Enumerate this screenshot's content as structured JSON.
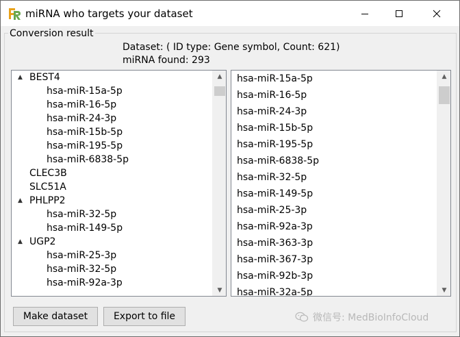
{
  "window": {
    "title": "miRNA who targets your dataset",
    "app_icon": "fr-logo-icon",
    "controls": [
      "minimize-icon",
      "maximize-icon",
      "close-icon"
    ]
  },
  "group": {
    "title": "Conversion result"
  },
  "info": {
    "dataset_line": "Dataset: ( ID type: Gene symbol, Count: 621)",
    "mirna_found": "miRNA found: 293"
  },
  "tree": {
    "rows": [
      {
        "type": "parent",
        "label": "BEST4",
        "expander": "▲"
      },
      {
        "type": "child",
        "label": "hsa-miR-15a-5p"
      },
      {
        "type": "child",
        "label": "hsa-miR-16-5p"
      },
      {
        "type": "child",
        "label": "hsa-miR-24-3p"
      },
      {
        "type": "child",
        "label": "hsa-miR-15b-5p"
      },
      {
        "type": "child",
        "label": "hsa-miR-195-5p"
      },
      {
        "type": "child",
        "label": "hsa-miR-6838-5p"
      },
      {
        "type": "leaf",
        "label": "CLEC3B"
      },
      {
        "type": "leaf",
        "label": "SLC51A"
      },
      {
        "type": "parent",
        "label": "PHLPP2",
        "expander": "▲"
      },
      {
        "type": "child",
        "label": "hsa-miR-32-5p"
      },
      {
        "type": "child",
        "label": "hsa-miR-149-5p"
      },
      {
        "type": "parent",
        "label": "UGP2",
        "expander": "▲"
      },
      {
        "type": "child",
        "label": "hsa-miR-25-3p"
      },
      {
        "type": "child",
        "label": "hsa-miR-32-5p"
      },
      {
        "type": "child",
        "label": "hsa-miR-92a-3p"
      }
    ]
  },
  "mirna_list": {
    "items": [
      "hsa-miR-15a-5p",
      "hsa-miR-16-5p",
      "hsa-miR-24-3p",
      "hsa-miR-15b-5p",
      "hsa-miR-195-5p",
      "hsa-miR-6838-5p",
      "hsa-miR-32-5p",
      "hsa-miR-149-5p",
      "hsa-miR-25-3p",
      "hsa-miR-92a-3p",
      "hsa-miR-363-3p",
      "hsa-miR-367-3p",
      "hsa-miR-92b-3p",
      "hsa-miR-32a-5p"
    ]
  },
  "buttons": {
    "make_dataset": "Make dataset",
    "export": "Export to file"
  },
  "watermark": {
    "text": "微信号: MedBioInfoCloud",
    "icon": "wechat-icon"
  },
  "colors": {
    "window_bg": "#f0f0f0",
    "panel_border": "#828790",
    "button_bg": "#e1e1e1",
    "scroll_thumb": "#cdcdcd"
  }
}
